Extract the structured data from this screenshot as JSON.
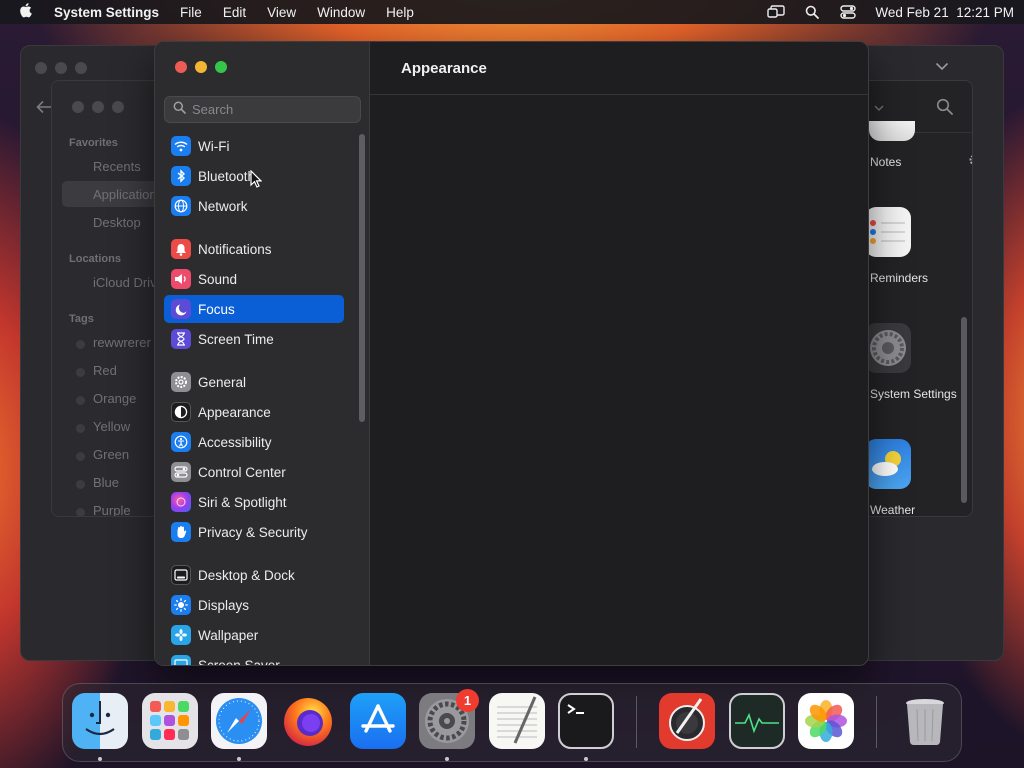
{
  "menubar": {
    "app_name": "System Settings",
    "menus": [
      "File",
      "Edit",
      "View",
      "Window",
      "Help"
    ],
    "clock": "Wed Feb 21  12:21 PM"
  },
  "finder": {
    "sidebar": {
      "favorites_header": "Favorites",
      "favorites": [
        "Recents",
        "Applications",
        "Desktop"
      ],
      "locations_header": "Locations",
      "locations": [
        "iCloud Drive"
      ],
      "tags_header": "Tags",
      "tags": [
        "rewwrerer",
        "Red",
        "Orange",
        "Yellow",
        "Green",
        "Blue",
        "Purple"
      ]
    },
    "apps": [
      "Notes",
      "Reminders",
      "System Settings",
      "Weather"
    ]
  },
  "settings": {
    "search_placeholder": "Search",
    "content_title": "Appearance",
    "items": [
      {
        "label": "Wi-Fi",
        "icon": "wifi-icon",
        "color": "#1a7df0"
      },
      {
        "label": "Bluetooth",
        "icon": "bluetooth-icon",
        "color": "#1a7df0"
      },
      {
        "label": "Network",
        "icon": "globe-icon",
        "color": "#1a7df0"
      },
      {
        "label": "Notifications",
        "icon": "bell-icon",
        "color": "#ec4b47"
      },
      {
        "label": "Sound",
        "icon": "speaker-icon",
        "color": "#ec4b6b"
      },
      {
        "label": "Focus",
        "icon": "moon-icon",
        "color": "#5b4bd6"
      },
      {
        "label": "Screen Time",
        "icon": "hourglass-icon",
        "color": "#5b4bd6"
      },
      {
        "label": "General",
        "icon": "gear-icon",
        "color": "#8e8e93"
      },
      {
        "label": "Appearance",
        "icon": "appearance-icon",
        "color": "#1c1c1e"
      },
      {
        "label": "Accessibility",
        "icon": "accessibility-icon",
        "color": "#1a7df0"
      },
      {
        "label": "Control Center",
        "icon": "control-center-icon",
        "color": "#8e8e93"
      },
      {
        "label": "Siri & Spotlight",
        "icon": "siri-icon",
        "color": "#b73ad6"
      },
      {
        "label": "Privacy & Security",
        "icon": "hand-icon",
        "color": "#1a7df0"
      },
      {
        "label": "Desktop & Dock",
        "icon": "dock-icon",
        "color": "#1c1c1e"
      },
      {
        "label": "Displays",
        "icon": "sun-icon",
        "color": "#1a7df0"
      },
      {
        "label": "Wallpaper",
        "icon": "wallpaper-icon",
        "color": "#2aa4e8"
      },
      {
        "label": "Screen Saver",
        "icon": "screen-saver-icon",
        "color": "#2aa4e8"
      }
    ],
    "selected": "Focus"
  },
  "dock": {
    "apps": [
      "Finder",
      "Launchpad",
      "Safari",
      "Firefox",
      "App Store",
      "System Settings",
      "TextEdit",
      "Terminal",
      "Digital Color Meter",
      "Activity Monitor",
      "Photos",
      "Trash"
    ],
    "badge": "1"
  }
}
